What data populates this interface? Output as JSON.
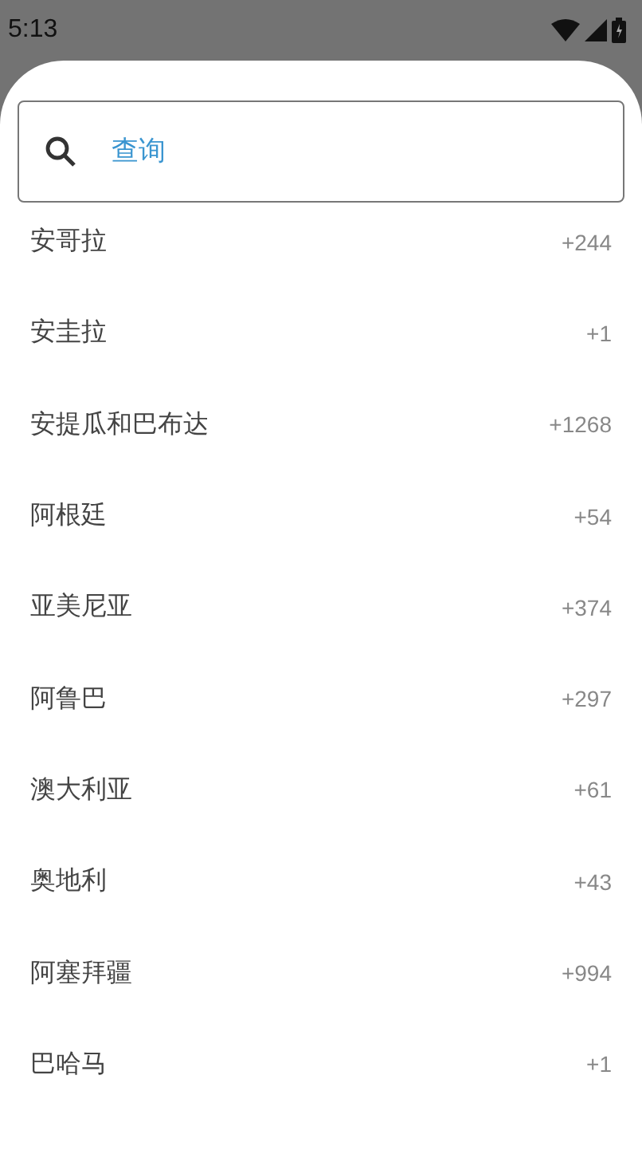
{
  "status_bar": {
    "time": "5:13"
  },
  "search": {
    "placeholder": "查询"
  },
  "countries": [
    {
      "name": "安哥拉",
      "code": "+244"
    },
    {
      "name": "安圭拉",
      "code": "+1"
    },
    {
      "name": "安提瓜和巴布达",
      "code": "+1268"
    },
    {
      "name": "阿根廷",
      "code": "+54"
    },
    {
      "name": "亚美尼亚",
      "code": "+374"
    },
    {
      "name": "阿鲁巴",
      "code": "+297"
    },
    {
      "name": "澳大利亚",
      "code": "+61"
    },
    {
      "name": "奥地利",
      "code": "+43"
    },
    {
      "name": "阿塞拜疆",
      "code": "+994"
    },
    {
      "name": "巴哈马",
      "code": "+1"
    }
  ]
}
